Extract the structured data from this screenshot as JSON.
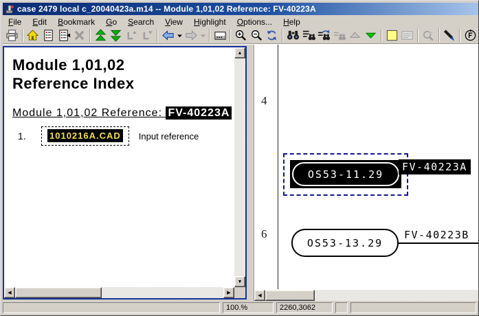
{
  "window": {
    "title": "case 2479 local c_20040423a.m14 -- Module 1,01,02 Reference: FV-40223A"
  },
  "menu": {
    "items": [
      {
        "label": "File"
      },
      {
        "label": "Edit"
      },
      {
        "label": "Bookmark"
      },
      {
        "label": "Go"
      },
      {
        "label": "Search"
      },
      {
        "label": "View"
      },
      {
        "label": "Highlight"
      },
      {
        "label": "Options..."
      },
      {
        "label": "Help"
      }
    ]
  },
  "toolbar": {
    "buttons": [
      {
        "name": "print",
        "disabled": false
      },
      {
        "name": "home",
        "disabled": false
      },
      {
        "name": "reference-index",
        "disabled": false
      },
      {
        "name": "reference-index-return",
        "disabled": false
      },
      {
        "name": "remove",
        "disabled": true
      },
      {
        "name": "go-top",
        "disabled": false
      },
      {
        "name": "go-bottom",
        "disabled": false
      },
      {
        "name": "label-previous",
        "disabled": true
      },
      {
        "name": "label-next",
        "disabled": true
      },
      {
        "name": "back",
        "disabled": false
      },
      {
        "name": "back-history",
        "disabled": false
      },
      {
        "name": "forward",
        "disabled": true
      },
      {
        "name": "forward-history",
        "disabled": true
      },
      {
        "name": "view-window",
        "disabled": false
      },
      {
        "name": "zoom-in",
        "disabled": false
      },
      {
        "name": "zoom-out",
        "disabled": false
      },
      {
        "name": "refresh",
        "disabled": false
      },
      {
        "name": "find",
        "disabled": false
      },
      {
        "name": "find-in-list",
        "disabled": false
      },
      {
        "name": "find-again",
        "disabled": false
      },
      {
        "name": "find-highlight",
        "disabled": true
      },
      {
        "name": "previous-match",
        "disabled": true
      },
      {
        "name": "next-match",
        "disabled": false
      },
      {
        "name": "highlight-color",
        "disabled": false
      },
      {
        "name": "annotations",
        "disabled": true
      },
      {
        "name": "zoom-tool",
        "disabled": true
      },
      {
        "name": "markup-pen",
        "disabled": false
      },
      {
        "name": "rotate",
        "disabled": false
      }
    ]
  },
  "left_pane": {
    "heading_line1": "Module 1,01,02",
    "heading_line2": "Reference Index",
    "reference_label": "Module 1,01,02 Reference: ",
    "reference_value": "FV-40223A",
    "items": [
      {
        "index": "1.",
        "code": "1010216A.CAD",
        "description": "Input reference"
      }
    ]
  },
  "right_pane": {
    "grid_labels": [
      "4",
      "6"
    ],
    "elements": [
      {
        "tag": "OS53-11.29",
        "reference": "FV-40223A",
        "highlighted": true
      },
      {
        "tag": "OS53-13.29",
        "reference": "FV-40223B",
        "highlighted": false
      }
    ]
  },
  "status_bar": {
    "zoom": "100.%",
    "coordinates": "2260,3062"
  },
  "colors": {
    "titlebar_left": "#0b2b74",
    "titlebar_right": "#a6c4ea",
    "chrome": "#d4d0c8",
    "pane_border": "#16339a",
    "highlight_yellow": "#f2e23c",
    "drawing_ink": "#000000",
    "disabled_gray": "#9a968f",
    "accent_blue": "#3355aa",
    "accent_green": "#00b400"
  }
}
